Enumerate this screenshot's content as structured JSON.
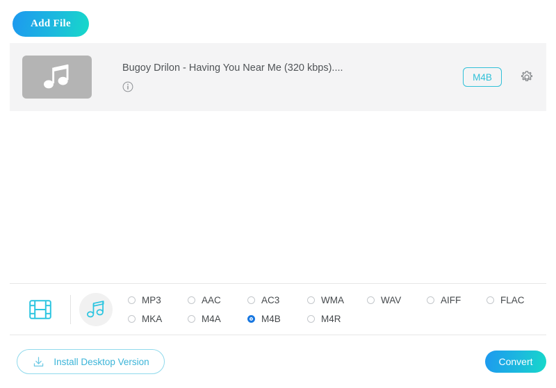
{
  "toolbar": {
    "add_file_label": "Add File"
  },
  "file_list": {
    "items": [
      {
        "name": "Bugoy Drilon - Having You Near Me (320 kbps)....",
        "thumbnail_icon": "music-note-icon",
        "info_icon": "info-circle-icon",
        "output_format": "M4B",
        "settings_icon": "gear-icon"
      }
    ]
  },
  "format_bar": {
    "video_tab_icon": "film-strip-icon",
    "audio_tab_icon": "music-note-icon",
    "selected_format": "M4B",
    "formats_row1": [
      "MP3",
      "AAC",
      "AC3",
      "WMA",
      "WAV",
      "AIFF",
      "FLAC"
    ],
    "formats_row2": [
      "MKA",
      "M4A",
      "M4B",
      "M4R"
    ]
  },
  "footer": {
    "install_label": "Install Desktop Version",
    "install_icon": "download-icon",
    "convert_label": "Convert"
  },
  "colors": {
    "accent_blue": "#1d99ef",
    "accent_cyan": "#17d9c9",
    "badge_cyan": "#2fc0d8",
    "radio_selected": "#1877e0",
    "row_background": "#f4f4f5",
    "thumbnail_gray": "#b4b4b4"
  }
}
